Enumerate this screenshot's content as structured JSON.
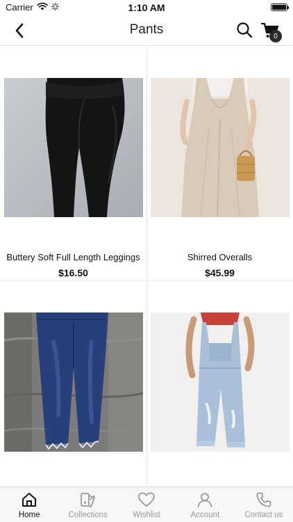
{
  "status_bar": {
    "carrier": "Carrier",
    "time": "1:10 AM"
  },
  "nav": {
    "title": "Pants",
    "cart_count": "0"
  },
  "products": [
    {
      "name": "Buttery Soft Full Length Leggings",
      "price": "$16.50",
      "image": "black-leggings"
    },
    {
      "name": "Shirred Overalls",
      "price": "$45.99",
      "image": "beige-overalls"
    },
    {
      "name": "",
      "price": "",
      "image": "distressed-jeans"
    },
    {
      "name": "",
      "price": "",
      "image": "denim-overalls"
    }
  ],
  "tabs": [
    {
      "label": "Home",
      "icon": "home-icon",
      "active": true
    },
    {
      "label": "Collections",
      "icon": "collections-icon",
      "active": false
    },
    {
      "label": "Wishlist",
      "icon": "heart-icon",
      "active": false
    },
    {
      "label": "Account",
      "icon": "user-icon",
      "active": false
    },
    {
      "label": "Contact us",
      "icon": "phone-icon",
      "active": false
    }
  ],
  "colors": {
    "tab_active": "#111111",
    "tab_inactive": "#9a9a9a",
    "badge": "#2b2b2b"
  }
}
